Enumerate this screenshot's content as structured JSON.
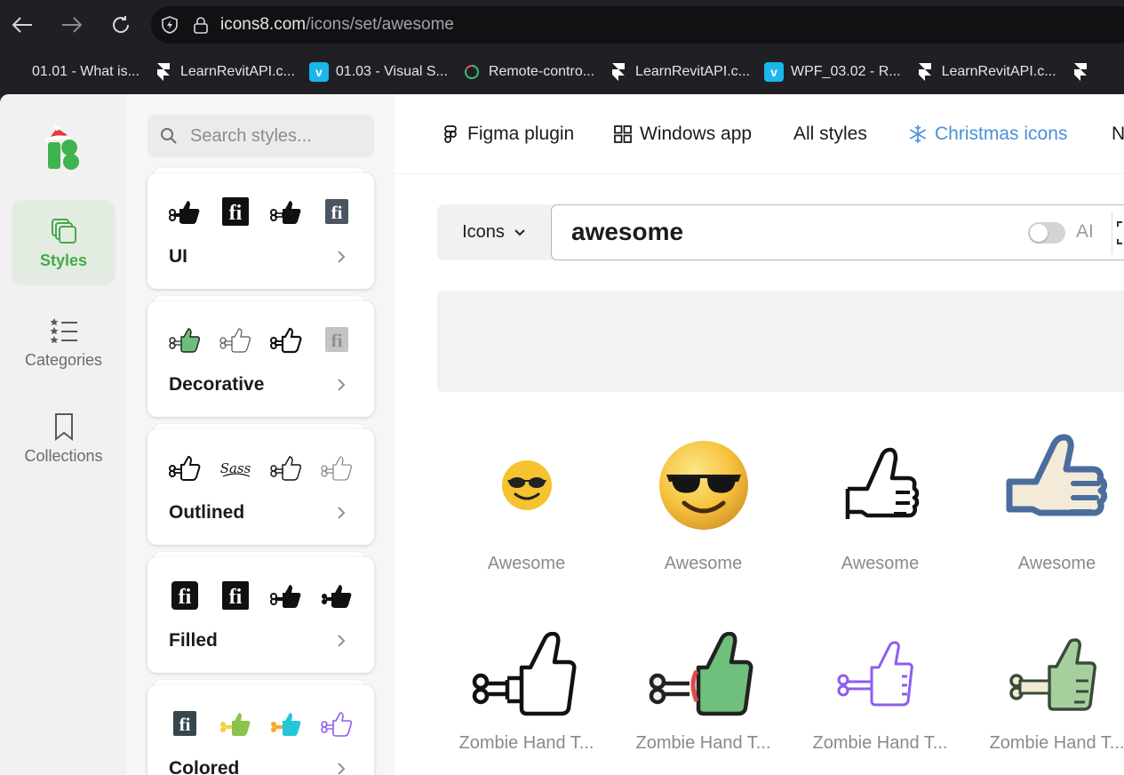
{
  "browser": {
    "url_host": "icons8.com",
    "url_path": "/icons/set/awesome",
    "bookmarks": [
      {
        "label": "01.01 - What is...",
        "icon": "generic-page-icon"
      },
      {
        "label": "LearnRevitAPI.c...",
        "icon": "framer-icon"
      },
      {
        "label": "01.03 - Visual S...",
        "icon": "vimeo-icon"
      },
      {
        "label": "Remote-contro...",
        "icon": "loading-spinner-icon"
      },
      {
        "label": "LearnRevitAPI.c...",
        "icon": "framer-icon"
      },
      {
        "label": "WPF_03.02 - R...",
        "icon": "vimeo-icon"
      },
      {
        "label": "LearnRevitAPI.c...",
        "icon": "framer-icon"
      }
    ]
  },
  "rail": {
    "items": [
      {
        "label": "Styles",
        "icon": "layers-icon",
        "active": true
      },
      {
        "label": "Categories",
        "icon": "star-list-icon",
        "active": false
      },
      {
        "label": "Collections",
        "icon": "bookmark-icon",
        "active": false
      }
    ]
  },
  "styles_panel": {
    "search_placeholder": "Search styles...",
    "cards": [
      {
        "name": "UI"
      },
      {
        "name": "Decorative"
      },
      {
        "name": "Outlined"
      },
      {
        "name": "Filled"
      },
      {
        "name": "Colored"
      }
    ]
  },
  "topnav": {
    "figma": "Figma plugin",
    "windows": "Windows app",
    "all_styles": "All styles",
    "christmas": "Christmas icons",
    "next_initial": "N"
  },
  "search": {
    "type_label": "Icons",
    "query": "awesome",
    "ai_label": "AI",
    "ai_enabled": false
  },
  "results": [
    {
      "label": "Awesome",
      "icon": "sunglasses-emoji-flat-icon"
    },
    {
      "label": "Awesome",
      "icon": "sunglasses-emoji-3d-icon"
    },
    {
      "label": "Awesome",
      "icon": "thumbs-up-outline-icon"
    },
    {
      "label": "Awesome",
      "icon": "thumbs-up-colored-icon"
    },
    {
      "label": "Zombie Hand T...",
      "icon": "zombie-hand-outline-icon"
    },
    {
      "label": "Zombie Hand T...",
      "icon": "zombie-hand-green-icon"
    },
    {
      "label": "Zombie Hand T...",
      "icon": "zombie-hand-purple-icon"
    },
    {
      "label": "Zombie Hand T...",
      "icon": "zombie-hand-pale-icon"
    }
  ],
  "colors": {
    "accent_green": "#47a94b",
    "christmas_blue": "#4a90d9"
  }
}
